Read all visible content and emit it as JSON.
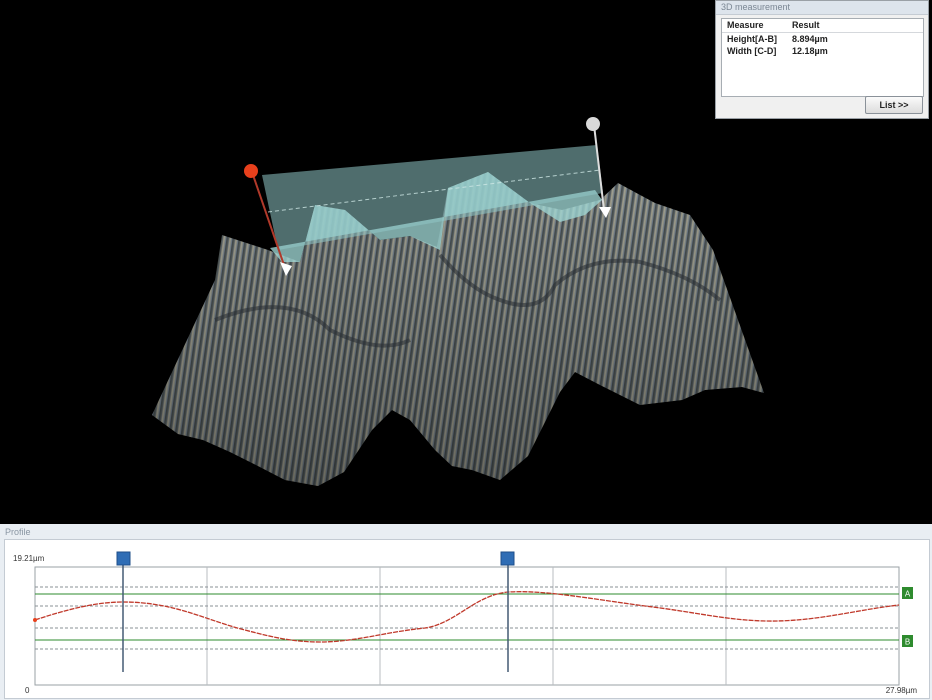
{
  "measurement_panel": {
    "title": "3D measurement",
    "headers": {
      "measure": "Measure",
      "result": "Result"
    },
    "rows": [
      {
        "measure": "Height[A-B]",
        "result": "8.894µm"
      },
      {
        "measure": "Width [C-D]",
        "result": "12.18µm"
      }
    ],
    "list_button": "List >>"
  },
  "profile_panel": {
    "title": "Profile",
    "y_max_label": "19.21µm",
    "x_min_label": "0",
    "x_max_label": "27.98µm",
    "marker_a": "A",
    "marker_b": "B"
  },
  "colors": {
    "profile_line": "#c0392b",
    "marker_red": "#e8401c",
    "marker_white": "#d9d9d9",
    "cursor_blue": "#2f6db5",
    "plane_teal": "#8fc7c7",
    "ab_marker_green": "#2e8b2e"
  },
  "icons": [
    "point-a-handle-icon",
    "point-b-handle-icon",
    "cursor-c-icon",
    "cursor-d-icon"
  ]
}
